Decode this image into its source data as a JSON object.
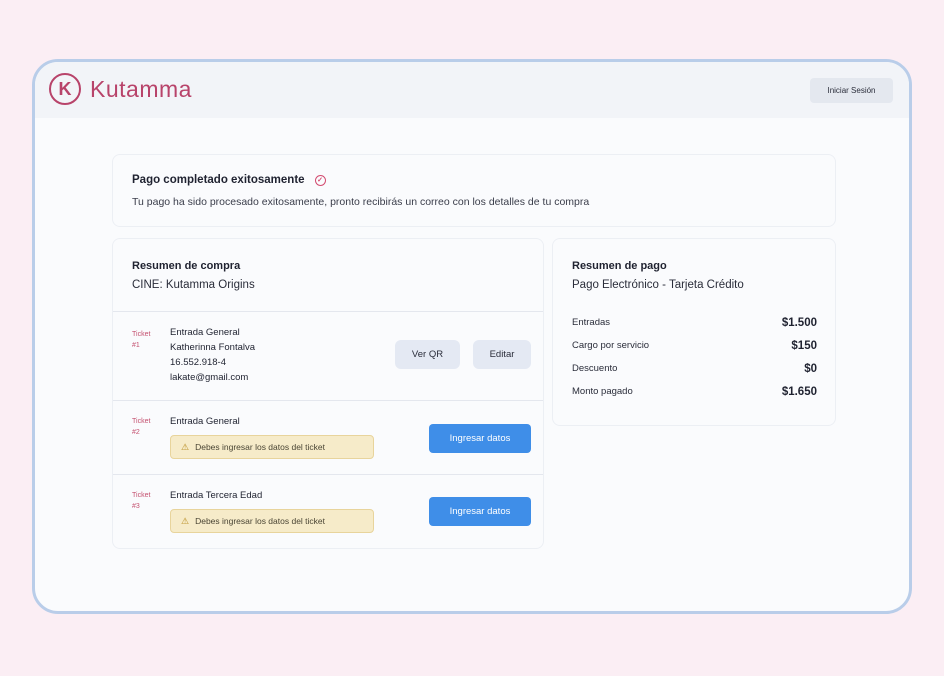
{
  "brand": {
    "logo_letter": "K",
    "name": "Kutamma",
    "color": "#b8436a"
  },
  "header": {
    "login_label": "Iniciar Sesión"
  },
  "banner": {
    "title": "Pago completado exitosamente",
    "description": "Tu pago ha sido procesado exitosamente, pronto recibirás un correo con los detalles de tu compra"
  },
  "purchase_summary": {
    "title": "Resumen de compra",
    "event": "CINE: Kutamma Origins",
    "tickets": [
      {
        "label": "Ticket #1",
        "type": "Entrada General",
        "name": "Katherinna Fontalva",
        "rut": "16.552.918-4",
        "email": "lakate@gmail.com",
        "qr_label": "Ver QR",
        "edit_label": "Editar"
      },
      {
        "label": "Ticket #2",
        "type": "Entrada General",
        "warning": "Debes ingresar los datos del ticket",
        "action_label": "Ingresar datos"
      },
      {
        "label": "Ticket #3",
        "type": "Entrada Tercera Edad",
        "warning": "Debes ingresar los datos del ticket",
        "action_label": "Ingresar datos"
      }
    ]
  },
  "payment_summary": {
    "title": "Resumen de pago",
    "method": "Pago Electrónico - Tarjeta Crédito",
    "rows": [
      {
        "label": "Entradas",
        "value": "$1.500"
      },
      {
        "label": "Cargo por servicio",
        "value": "$150"
      },
      {
        "label": "Descuento",
        "value": "$0"
      },
      {
        "label": "Monto pagado",
        "value": "$1.650"
      }
    ]
  },
  "colors": {
    "accent": "#3f8ee8",
    "warning_bg": "#f6ebc9",
    "ticket_label": "#c4506f"
  }
}
